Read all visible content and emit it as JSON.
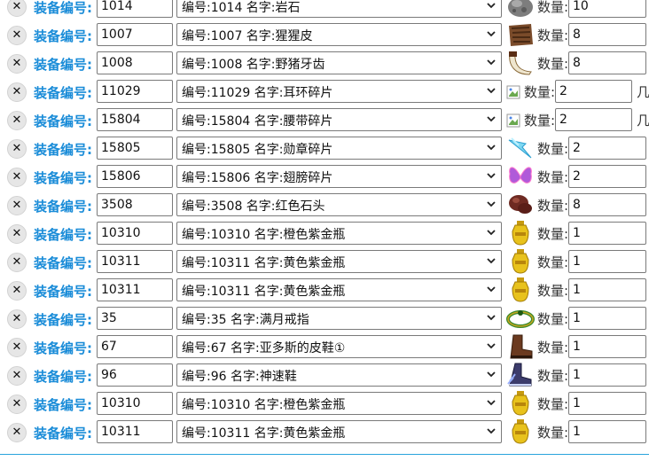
{
  "rows": [
    {
      "label": "装备编号:",
      "id": "1014",
      "option": "编号:1014 名字:岩石",
      "icon": "rock-icon",
      "qty_label": "数量:",
      "qty": "10"
    },
    {
      "label": "装备编号:",
      "id": "1007",
      "option": "编号:1007 名字:猩猩皮",
      "icon": "ape-hide-icon",
      "qty_label": "数量:",
      "qty": "8"
    },
    {
      "label": "装备编号:",
      "id": "1008",
      "option": "编号:1008 名字:野猪牙齿",
      "icon": "boar-tusk-icon",
      "qty_label": "数量:",
      "qty": "8"
    },
    {
      "label": "装备编号:",
      "id": "11029",
      "option": "编号:11029 名字:耳环碎片",
      "icon": "broken-image-icon",
      "qty_label": "数量:",
      "qty": "2",
      "suffix": "几"
    },
    {
      "label": "装备编号:",
      "id": "15804",
      "option": "编号:15804 名字:腰带碎片",
      "icon": "broken-image-icon",
      "qty_label": "数量:",
      "qty": "2",
      "suffix": "几"
    },
    {
      "label": "装备编号:",
      "id": "15805",
      "option": "编号:15805 名字:勋章碎片",
      "icon": "medal-shard-icon",
      "qty_label": "数量:",
      "qty": "2"
    },
    {
      "label": "装备编号:",
      "id": "15806",
      "option": "编号:15806 名字:翅膀碎片",
      "icon": "wing-shard-icon",
      "qty_label": "数量:",
      "qty": "2"
    },
    {
      "label": "装备编号:",
      "id": "3508",
      "option": "编号:3508 名字:红色石头",
      "icon": "red-stone-icon",
      "qty_label": "数量:",
      "qty": "8"
    },
    {
      "label": "装备编号:",
      "id": "10310",
      "option": "编号:10310 名字:橙色紫金瓶",
      "icon": "gold-vase-icon",
      "qty_label": "数量:",
      "qty": "1"
    },
    {
      "label": "装备编号:",
      "id": "10311",
      "option": "编号:10311 名字:黄色紫金瓶",
      "icon": "gold-vase-icon",
      "qty_label": "数量:",
      "qty": "1"
    },
    {
      "label": "装备编号:",
      "id": "10311",
      "option": "编号:10311 名字:黄色紫金瓶",
      "icon": "gold-vase-icon",
      "qty_label": "数量:",
      "qty": "1"
    },
    {
      "label": "装备编号:",
      "id": "35",
      "option": "编号:35 名字:满月戒指",
      "icon": "ring-icon",
      "qty_label": "数量:",
      "qty": "1"
    },
    {
      "label": "装备编号:",
      "id": "67",
      "option": "编号:67 名字:亚多斯的皮鞋①",
      "icon": "leather-boot-icon",
      "qty_label": "数量:",
      "qty": "1"
    },
    {
      "label": "装备编号:",
      "id": "96",
      "option": "编号:96 名字:神速鞋",
      "icon": "speed-shoe-icon",
      "qty_label": "数量:",
      "qty": "1"
    },
    {
      "label": "装备编号:",
      "id": "10310",
      "option": "编号:10310 名字:橙色紫金瓶",
      "icon": "gold-vase-icon",
      "qty_label": "数量:",
      "qty": "1"
    },
    {
      "label": "装备编号:",
      "id": "10311",
      "option": "编号:10311 名字:黄色紫金瓶",
      "icon": "gold-vase-icon",
      "qty_label": "数量:",
      "qty": "1"
    }
  ],
  "colors": {
    "label": "#1a8cd8",
    "rule": "#29a3dd"
  }
}
